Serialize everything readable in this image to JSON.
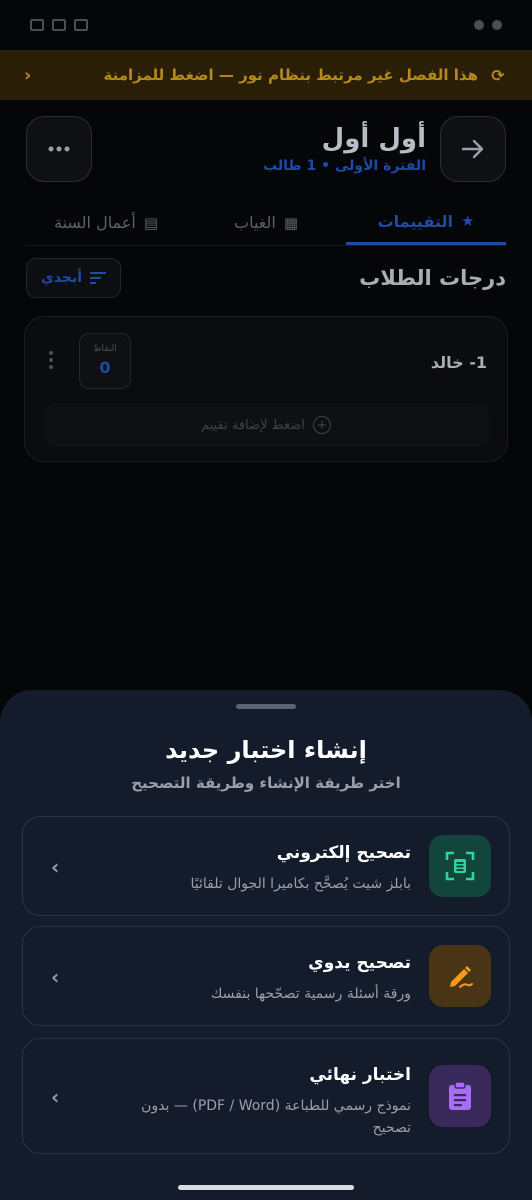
{
  "sync_banner": {
    "text": "هذا الفصل غير مرتبط بنظام نور — اضغط للمزامنة",
    "chevron": "‹",
    "icon": "sync-warning-icon"
  },
  "header": {
    "title": "أول أول",
    "subtitle": "الفترة الأولى • 1 طالب",
    "back_icon": "arrow-right-icon",
    "more_icon": "more-dots-icon"
  },
  "tabs": [
    {
      "label": "التقييمات",
      "icon": "star-icon",
      "active": true
    },
    {
      "label": "الغياب",
      "icon": "calendar-x-icon",
      "active": false
    },
    {
      "label": "أعمال السنة",
      "icon": "clipboard-icon",
      "active": false
    }
  ],
  "section": {
    "title": "درجات الطلاب",
    "sort_label": "أبجدي"
  },
  "student": {
    "name": "1- خالد",
    "points_label": "النقاط",
    "points_value": "0",
    "add_label": "اضغط لإضافة تقييم"
  },
  "sheet": {
    "title": "إنشاء اختبار جديد",
    "subtitle": "اختر طريقة الإنشاء وطريقة التصحيح",
    "options": [
      {
        "title": "تصحيح إلكتروني",
        "desc": "بابلز شيت يُصحَّح بكاميرا الجوال تلقائيًا",
        "icon": "scan-icon",
        "icon_bg": "#12453b",
        "icon_color": "#2fd49a"
      },
      {
        "title": "تصحيح يدوي",
        "desc": "ورقة أسئلة رسمية تصحّحها بنفسك",
        "icon": "pen-icon",
        "icon_bg": "#4a3416",
        "icon_color": "#f59a1c"
      },
      {
        "title": "اختبار نهائي",
        "desc": "نموذج رسمي للطباعة (PDF / Word) — بدون تصحيح",
        "icon": "clipboard-list-icon",
        "icon_bg": "#3a2a5c",
        "icon_color": "#a86cf5"
      }
    ]
  },
  "colors": {
    "accent": "#1e4aa8",
    "banner": "#b48a1e",
    "sheet_bg": "#141c2b"
  }
}
